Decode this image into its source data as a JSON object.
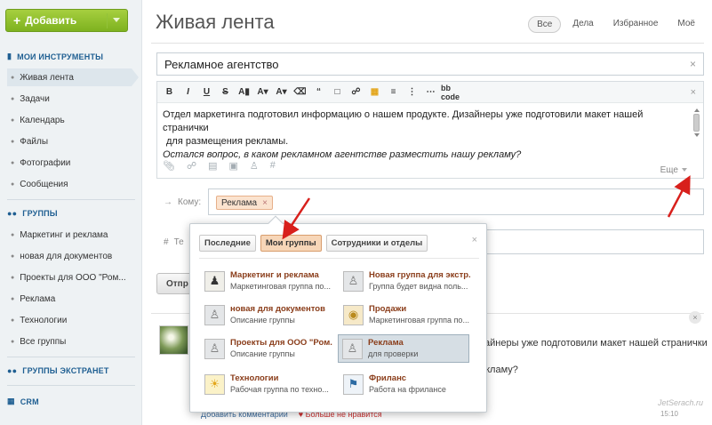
{
  "sidebar": {
    "add_button": "Добавить",
    "tools_header": "МОИ ИНСТРУМЕНТЫ",
    "tools": [
      "Живая лента",
      "Задачи",
      "Календарь",
      "Файлы",
      "Фотографии",
      "Сообщения"
    ],
    "groups_header": "ГРУППЫ",
    "groups": [
      "Маркетинг и реклама",
      "новая для документов",
      "Проекты для ООО \"Ром...",
      "Реклама",
      "Технологии",
      "Все группы"
    ],
    "extranet_header": "ГРУППЫ ЭКСТРАНЕТ",
    "crm_header": "CRM"
  },
  "header": {
    "title": "Живая лента",
    "tabs": [
      "Все",
      "Дела",
      "Избранное",
      "Моё"
    ]
  },
  "post": {
    "subject": "Рекламное агентство",
    "toolbar_bbcode": "bb code",
    "text_line1": "Отдел маркетинга подготовил информацию о нашем продукте. Дизайнеры уже подготовили макет нашей странички",
    "text_line2": "для размещения рекламы.",
    "text_line3": "Остался вопрос, в каком рекламном агентстве разместить нашу рекламу?",
    "more_label": "Еще",
    "to_label": "Кому:",
    "to_chip": "Реклама",
    "tag_label": "Те",
    "send_label": "Отпр"
  },
  "popup": {
    "tabs": [
      "Последние",
      "Мои группы",
      "Сотрудники и отделы"
    ],
    "groups": [
      {
        "name": "Маркетинг и реклама",
        "desc": "Маркетинговая группа по...",
        "icon": "person-photo-icon"
      },
      {
        "name": "Новая группа для экстр...",
        "desc": "Группа будет видна поль...",
        "icon": "group-people-icon"
      },
      {
        "name": "новая для документов",
        "desc": "Описание группы",
        "icon": "group-people-icon"
      },
      {
        "name": "Продажи",
        "desc": "Маркетинговая группа по...",
        "icon": "coins-icon"
      },
      {
        "name": "Проекты для ООО \"Ром...",
        "desc": "Описание группы",
        "icon": "group-people-icon"
      },
      {
        "name": "Реклама",
        "desc": "для проверки",
        "icon": "group-people-icon"
      },
      {
        "name": "Технологии",
        "desc": "Рабочая группа по техно...",
        "icon": "lamp-icon"
      },
      {
        "name": "Фриланс",
        "desc": "Работа на фрилансе",
        "icon": "flag-icon"
      }
    ]
  },
  "feed": {
    "text1": "зайнеры уже подготовили макет нашей странички",
    "text2": "екламу?",
    "bottom_link": "Добавить комментарий",
    "bottom_like": "Больше не нравится",
    "time": "15:10",
    "watermark": "JetSerach.ru"
  },
  "colors": {
    "accent_green": "#8ac231",
    "nav_blue": "#1f5f92",
    "group_name": "#8a3d1a",
    "chip_bg": "#fbe3cf",
    "annotation_red": "#d8201c"
  }
}
